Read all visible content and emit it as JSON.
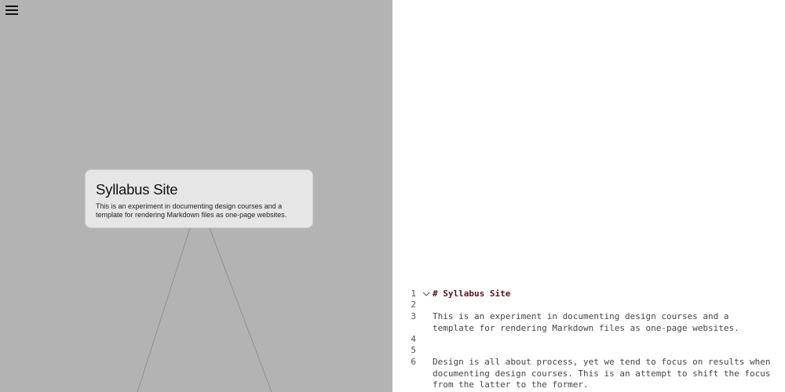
{
  "preview": {
    "menu_icon": "hamburger-menu-icon",
    "card": {
      "title": "Syllabus Site",
      "description": "This is an experiment in documenting design courses and a template for rendering Markdown files as one-page websites."
    }
  },
  "editor": {
    "fold_icon": "chevron-down-icon",
    "heading_color": "#5a1020",
    "lines": [
      {
        "number": "1",
        "text": "# Syllabus Site"
      },
      {
        "number": "2",
        "text": ""
      },
      {
        "number": "3",
        "text": "This is an experiment in documenting design courses and a template for rendering Markdown files as one-page websites."
      },
      {
        "number": "4",
        "text": ""
      },
      {
        "number": "5",
        "text": ""
      },
      {
        "number": "6",
        "text": "Design is all about process, yet we tend to focus on results when documenting design courses. This is an attempt to shift the focus from the latter to the former."
      }
    ]
  }
}
